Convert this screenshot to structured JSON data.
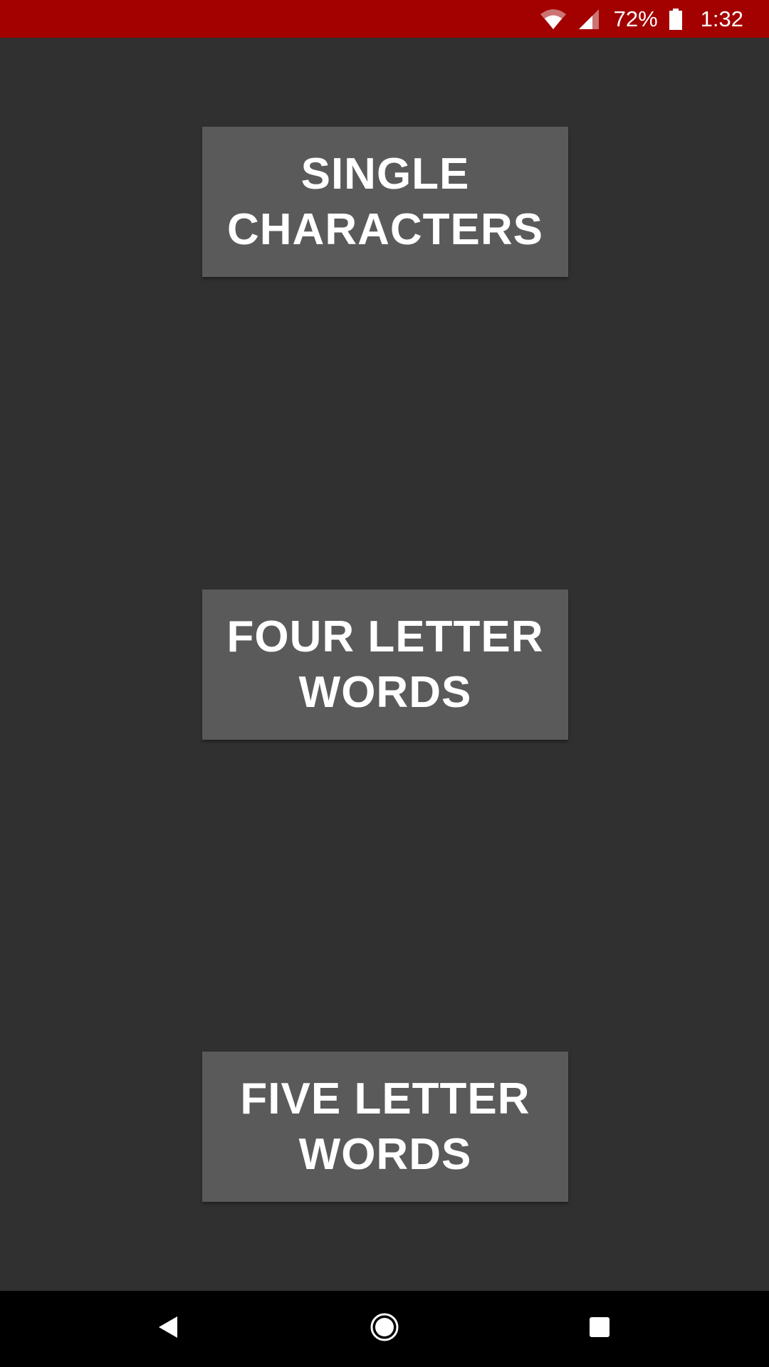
{
  "status_bar": {
    "battery_percent": "72%",
    "time": "1:32",
    "icons": [
      "wifi-icon",
      "cell-signal-icon",
      "battery-icon"
    ]
  },
  "menu": {
    "buttons": [
      {
        "label": "SINGLE CHARACTERS"
      },
      {
        "label": "FOUR LETTER WORDS"
      },
      {
        "label": "FIVE LETTER WORDS"
      }
    ]
  },
  "nav_bar": {
    "icons": [
      "back-icon",
      "home-icon",
      "recents-icon"
    ]
  },
  "colors": {
    "status_bar": "#a30000",
    "background": "#303030",
    "button": "#5a5a5b",
    "button_text": "#ffffff",
    "nav_bar": "#000000"
  }
}
